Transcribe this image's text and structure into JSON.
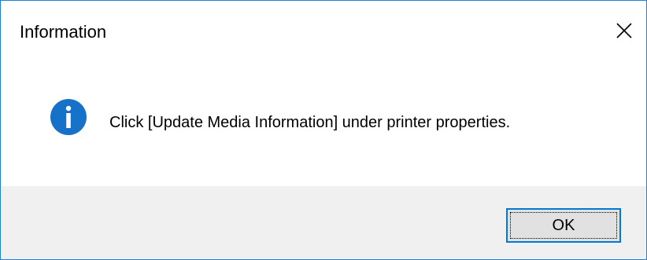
{
  "window": {
    "title": "Information",
    "close_icon": "close-icon",
    "border_color": "#1883d7"
  },
  "message": {
    "icon": "info-icon",
    "icon_color": "#1572c8",
    "text": "Click [Update Media Information] under printer properties."
  },
  "footer": {
    "ok_label": "OK",
    "background": "#f0f0f0",
    "button_border_color": "#0078d7"
  }
}
